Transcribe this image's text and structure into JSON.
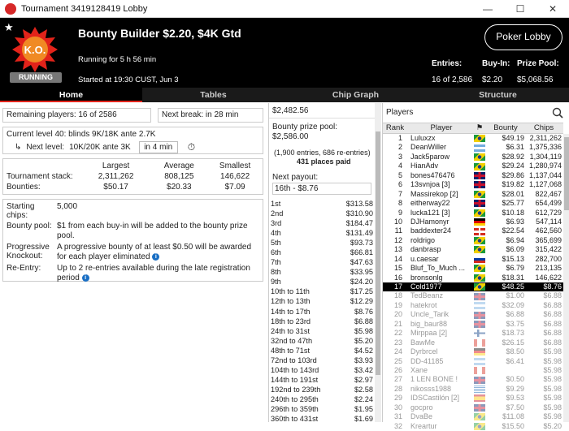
{
  "window": {
    "title": "Tournament 3419128419 Lobby",
    "minimize": "—",
    "maximize": "☐",
    "close": "✕"
  },
  "header": {
    "tournament_name": "Bounty Builder $2.20, $4K Gtd",
    "running_for": "Running for 5 h 56 min",
    "started_at": "Started at 19:30 CUST, Jun 3",
    "badge": "RUNNING",
    "logo_text": "K.O.",
    "lobby_button": "Poker Lobby",
    "entries_label": "Entries:",
    "entries_value": "16 of 2,586",
    "buyin_label": "Buy-In:",
    "buyin_value": "$2.20",
    "prizepool_label": "Prize Pool:",
    "prizepool_value": "$5,068.56",
    "accent": "#e2231a"
  },
  "tabs": [
    "Home",
    "Tables",
    "Chip Graph",
    "Structure"
  ],
  "home": {
    "remaining": "Remaining players: 16 of 2586",
    "next_break": "Next break: in 28 min",
    "current_level": "Current level 40:  blinds 9K/18K ante 2.7K",
    "next_level_label": "Next level:",
    "next_level": "10K/20K ante 3K",
    "next_level_time": "in 4 min",
    "stack_headers": [
      "Largest",
      "Average",
      "Smallest"
    ],
    "stack_label": "Tournament stack:",
    "stack_values": [
      "2,311,262",
      "808,125",
      "146,622"
    ],
    "bounties_label": "Bounties:",
    "bounties_values": [
      "$50.17",
      "$20.33",
      "$7.09"
    ],
    "starting_chips_label": "Starting chips:",
    "starting_chips": "5,000",
    "bounty_pool_label": "Bounty pool:",
    "bounty_pool": "$1 from each buy-in will be added to the bounty prize pool.",
    "progressive_label": "Progressive Knockout:",
    "progressive": "A progressive bounty of at least $0.50 will be awarded for each player eliminated",
    "reentry_label": "Re-Entry:",
    "reentry": "Up to 2 re-entries available during the late registration period"
  },
  "prizes": {
    "top_value": "$2,482.56",
    "bounty_pool_label": "Bounty prize pool:",
    "bounty_pool_value": "$2,586.00",
    "entries_note": "(1,900 entries, 686 re-entries)",
    "places_paid": "431 places paid",
    "next_payout_label": "Next payout:",
    "next_payout_value": "16th - $8.76",
    "payouts": [
      [
        "1st",
        "$313.58"
      ],
      [
        "2nd",
        "$310.90"
      ],
      [
        "3rd",
        "$184.47"
      ],
      [
        "4th",
        "$131.49"
      ],
      [
        "5th",
        "$93.73"
      ],
      [
        "6th",
        "$66.81"
      ],
      [
        "7th",
        "$47.63"
      ],
      [
        "8th",
        "$33.95"
      ],
      [
        "9th",
        "$24.20"
      ],
      [
        "10th to 11th",
        "$17.25"
      ],
      [
        "12th to 13th",
        "$12.29"
      ],
      [
        "14th to 17th",
        "$8.76"
      ],
      [
        "18th to 23rd",
        "$6.88"
      ],
      [
        "24th to 31st",
        "$5.98"
      ],
      [
        "32nd to 47th",
        "$5.20"
      ],
      [
        "48th to 71st",
        "$4.52"
      ],
      [
        "72nd to 103rd",
        "$3.93"
      ],
      [
        "104th to 143rd",
        "$3.42"
      ],
      [
        "144th to 191st",
        "$2.97"
      ],
      [
        "192nd to 239th",
        "$2.58"
      ],
      [
        "240th to 295th",
        "$2.24"
      ],
      [
        "296th to 359th",
        "$1.95"
      ],
      [
        "360th to 431st",
        "$1.69"
      ]
    ]
  },
  "players": {
    "title": "Players",
    "columns": [
      "Rank",
      "Player",
      "",
      "Bounty",
      "Chips"
    ],
    "rows": [
      {
        "rank": "1",
        "name": "Luluxzx",
        "flag": "br",
        "bounty": "$49.19",
        "chips": "2,311,262"
      },
      {
        "rank": "2",
        "name": "DeanWiller",
        "flag": "ar",
        "bounty": "$6.31",
        "chips": "1,375,336"
      },
      {
        "rank": "3",
        "name": "Jack5parow",
        "flag": "br",
        "bounty": "$28.92",
        "chips": "1,304,119"
      },
      {
        "rank": "4",
        "name": "HianAdv",
        "flag": "br",
        "bounty": "$29.24",
        "chips": "1,280,974"
      },
      {
        "rank": "5",
        "name": "bones476476",
        "flag": "gb",
        "bounty": "$29.86",
        "chips": "1,137,044"
      },
      {
        "rank": "6",
        "name": "13svnjoa [3]",
        "flag": "gb",
        "bounty": "$19.82",
        "chips": "1,127,068"
      },
      {
        "rank": "7",
        "name": "Massirekop [2]",
        "flag": "br",
        "bounty": "$28.01",
        "chips": "822,467"
      },
      {
        "rank": "8",
        "name": "eitherway22",
        "flag": "gb",
        "bounty": "$25.77",
        "chips": "654,499"
      },
      {
        "rank": "9",
        "name": "lucka121 [3]",
        "flag": "br",
        "bounty": "$10.18",
        "chips": "612,729"
      },
      {
        "rank": "10",
        "name": "DJHamonyr",
        "flag": "de",
        "bounty": "$6.93",
        "chips": "547,114"
      },
      {
        "rank": "11",
        "name": "baddexter24",
        "flag": "ch",
        "bounty": "$22.54",
        "chips": "462,560"
      },
      {
        "rank": "12",
        "name": "roldrigo",
        "flag": "br",
        "bounty": "$6.94",
        "chips": "365,699"
      },
      {
        "rank": "13",
        "name": "danbrasp",
        "flag": "br",
        "bounty": "$6.09",
        "chips": "315,422"
      },
      {
        "rank": "14",
        "name": "u.caesar",
        "flag": "ru",
        "bounty": "$15.13",
        "chips": "282,700"
      },
      {
        "rank": "15",
        "name": "Bluf_To_Much ...",
        "flag": "br",
        "bounty": "$6.79",
        "chips": "213,135"
      },
      {
        "rank": "16",
        "name": "bronsonlg",
        "flag": "br",
        "bounty": "$18.31",
        "chips": "146,622"
      },
      {
        "rank": "17",
        "name": "Cold1977",
        "flag": "br",
        "bounty": "$48.25",
        "chips": "$8.76",
        "selected": true
      },
      {
        "rank": "18",
        "name": "TedBeanz",
        "flag": "gb",
        "bounty": "$1.00",
        "chips": "$6.88",
        "elim": true
      },
      {
        "rank": "19",
        "name": "hatekrot",
        "flag": "ar",
        "bounty": "$32.09",
        "chips": "$6.88",
        "elim": true
      },
      {
        "rank": "20",
        "name": "Uncle_Tarik",
        "flag": "gb",
        "bounty": "$6.88",
        "chips": "$6.88",
        "elim": true
      },
      {
        "rank": "21",
        "name": "big_baur88",
        "flag": "gb",
        "bounty": "$3.75",
        "chips": "$6.88",
        "elim": true
      },
      {
        "rank": "22",
        "name": "Mirppaa [2]",
        "flag": "fi",
        "bounty": "$18.73",
        "chips": "$6.88",
        "elim": true
      },
      {
        "rank": "23",
        "name": "BawMe",
        "flag": "ca",
        "bounty": "$26.15",
        "chips": "$6.88",
        "elim": true
      },
      {
        "rank": "24",
        "name": "Dyrbrcel",
        "flag": "de",
        "bounty": "$8.50",
        "chips": "$5.98",
        "elim": true
      },
      {
        "rank": "25",
        "name": "DD-41185",
        "flag": "ar",
        "bounty": "$6.41",
        "chips": "$5.98",
        "elim": true
      },
      {
        "rank": "26",
        "name": "Xane",
        "flag": "ca",
        "bounty": "",
        "chips": "$5.98",
        "elim": true
      },
      {
        "rank": "27",
        "name": "1 LEN BONE !",
        "flag": "gb",
        "bounty": "$0.50",
        "chips": "$5.98",
        "elim": true
      },
      {
        "rank": "28",
        "name": "nikosss1988",
        "flag": "gr",
        "bounty": "$9.29",
        "chips": "$5.98",
        "elim": true
      },
      {
        "rank": "29",
        "name": "IDSCastilón [2]",
        "flag": "es",
        "bounty": "$9.53",
        "chips": "$5.98",
        "elim": true
      },
      {
        "rank": "30",
        "name": "gocpro",
        "flag": "gb",
        "bounty": "$7.50",
        "chips": "$5.98",
        "elim": true
      },
      {
        "rank": "31",
        "name": "DvaBe",
        "flag": "br",
        "bounty": "$11.08",
        "chips": "$5.98",
        "elim": true
      },
      {
        "rank": "32",
        "name": "Kreartur",
        "flag": "br",
        "bounty": "$15.50",
        "chips": "$5.20",
        "elim": true
      }
    ]
  }
}
